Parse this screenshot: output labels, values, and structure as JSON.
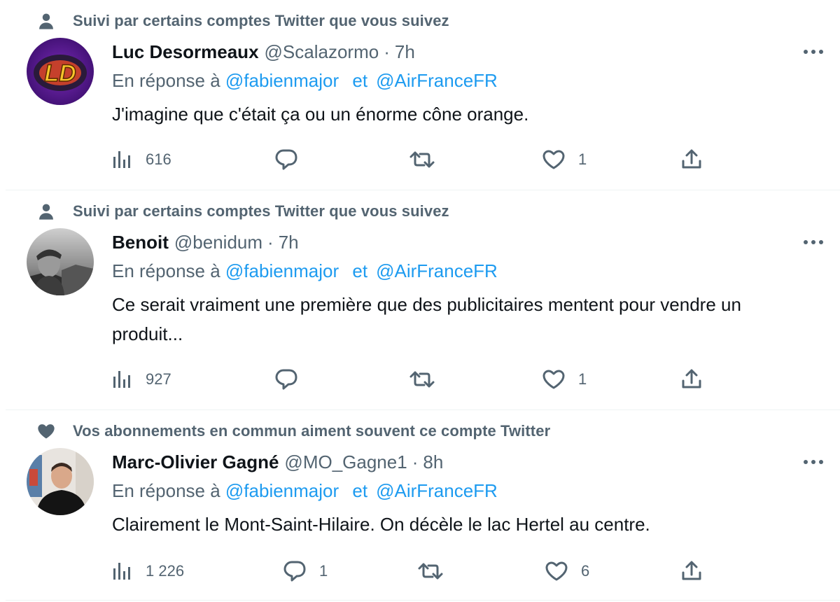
{
  "tweets": [
    {
      "social_context": "Suivi par certains comptes Twitter que vous suivez",
      "social_icon": "person-icon",
      "name": "Luc Desormeaux",
      "handle": "@Scalazormo",
      "time": "7h",
      "reply_prefix": "En réponse à",
      "reply_user1": "@fabienmajor",
      "reply_and": "et",
      "reply_user2": "@AirFranceFR",
      "text": "J'imagine que c'était ça ou un énorme cône orange.",
      "views": "616",
      "replies": "",
      "retweets": "",
      "likes": "1",
      "avatar_initials": "LD"
    },
    {
      "social_context": "Suivi par certains comptes Twitter que vous suivez",
      "social_icon": "person-icon",
      "name": "Benoit",
      "handle": "@benidum",
      "time": "7h",
      "reply_prefix": "En réponse à",
      "reply_user1": "@fabienmajor",
      "reply_and": "et",
      "reply_user2": "@AirFranceFR",
      "text": "Ce serait vraiment une première que des publicitaires mentent pour vendre un produit...",
      "views": "927",
      "replies": "",
      "retweets": "",
      "likes": "1"
    },
    {
      "social_context": "Vos abonnements en commun aiment souvent ce compte Twitter",
      "social_icon": "heart-icon",
      "name": "Marc-Olivier Gagné",
      "handle": "@MO_Gagne1",
      "time": "8h",
      "reply_prefix": "En réponse à",
      "reply_user1": "@fabienmajor",
      "reply_and": "et",
      "reply_user2": "@AirFranceFR",
      "text": "Clairement le Mont-Saint-Hilaire. On décèle le lac Hertel au centre.",
      "views": "1 226",
      "replies": "1",
      "retweets": "",
      "likes": "6"
    }
  ],
  "separator": "·",
  "colors": {
    "text": "#0f1419",
    "secondary": "#536471",
    "link": "#1d9bf0",
    "border": "#eff3f4"
  }
}
